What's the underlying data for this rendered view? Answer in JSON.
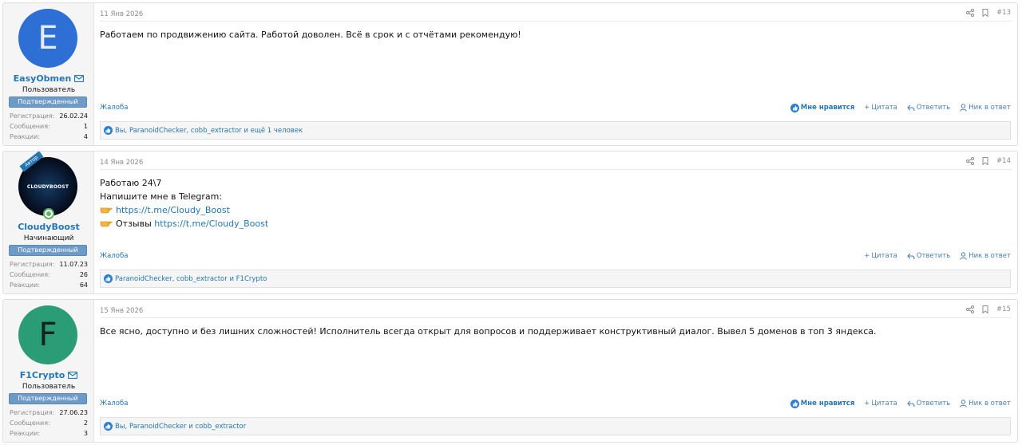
{
  "posts": [
    {
      "username": "EasyObmen",
      "avatar_letter": "E",
      "user_title": "Пользователь",
      "banner": "Подтвержденный",
      "stats": [
        {
          "label": "Регистрация:",
          "value": "26.02.24"
        },
        {
          "label": "Сообщения:",
          "value": "1"
        },
        {
          "label": "Реакции:",
          "value": "4"
        }
      ],
      "date": "11 Янв 2026",
      "post_num": "#13",
      "message": "Работаем по продвижению сайта. Работой доволен. Всё в срок и с отчётами рекомендую!",
      "report": "Жалоба",
      "like": "Мне нравится",
      "quote": "Цитата",
      "reply": "Ответить",
      "mention": "Ник в ответ",
      "likes": "Вы, ParanoidChecker, cobb_extractor и ещё 1 человек"
    },
    {
      "username": "CloudyBoost",
      "avatar_text": "CLOUDYBOOST",
      "author_badge": "Автор",
      "user_title": "Начинающий",
      "banner": "Подтвержденный",
      "stats": [
        {
          "label": "Регистрация:",
          "value": "11.07.23"
        },
        {
          "label": "Сообщения:",
          "value": "26"
        },
        {
          "label": "Реакции:",
          "value": "64"
        }
      ],
      "date": "14 Янв 2026",
      "post_num": "#14",
      "lines": [
        "Работаю 24\\7",
        "Напишите мне в Telegram:"
      ],
      "link1": "https://t.me/Cloudy_Boost",
      "reviews_label": "Отзывы",
      "link2": "https://t.me/Cloudy_Boost",
      "report": "Жалоба",
      "quote": "Цитата",
      "reply": "Ответить",
      "mention": "Ник в ответ",
      "likes": "ParanoidChecker, cobb_extractor и F1Crypto"
    },
    {
      "username": "F1Crypto",
      "avatar_letter": "F",
      "user_title": "Пользователь",
      "banner": "Подтвержденный",
      "stats": [
        {
          "label": "Регистрация:",
          "value": "27.06.23"
        },
        {
          "label": "Сообщения:",
          "value": "2"
        },
        {
          "label": "Реакции:",
          "value": "3"
        }
      ],
      "date": "15 Янв 2026",
      "post_num": "#15",
      "message": "Все ясно, доступно и без лишних сложностей! Исполнитель всегда открыт для вопросов и поддерживает конструктивный диалог. Вывел 5 доменов в топ 3 яндекса.",
      "report": "Жалоба",
      "like": "Мне нравится",
      "quote": "Цитата",
      "reply": "Ответить",
      "mention": "Ник в ответ",
      "likes": "Вы, ParanoidChecker и cobb_extractor"
    }
  ],
  "icons": [
    "envelope-icon",
    "share-icon",
    "bookmark-icon",
    "thumbs-up-icon",
    "plus-icon",
    "reply-icon",
    "person-icon",
    "pointing-hand-icon",
    "online-icon"
  ],
  "colors": {
    "link": "#2577b1",
    "banner": "#6d9ac7",
    "avatar_e": "#2e6fd6",
    "avatar_f": "#2a9d76"
  }
}
